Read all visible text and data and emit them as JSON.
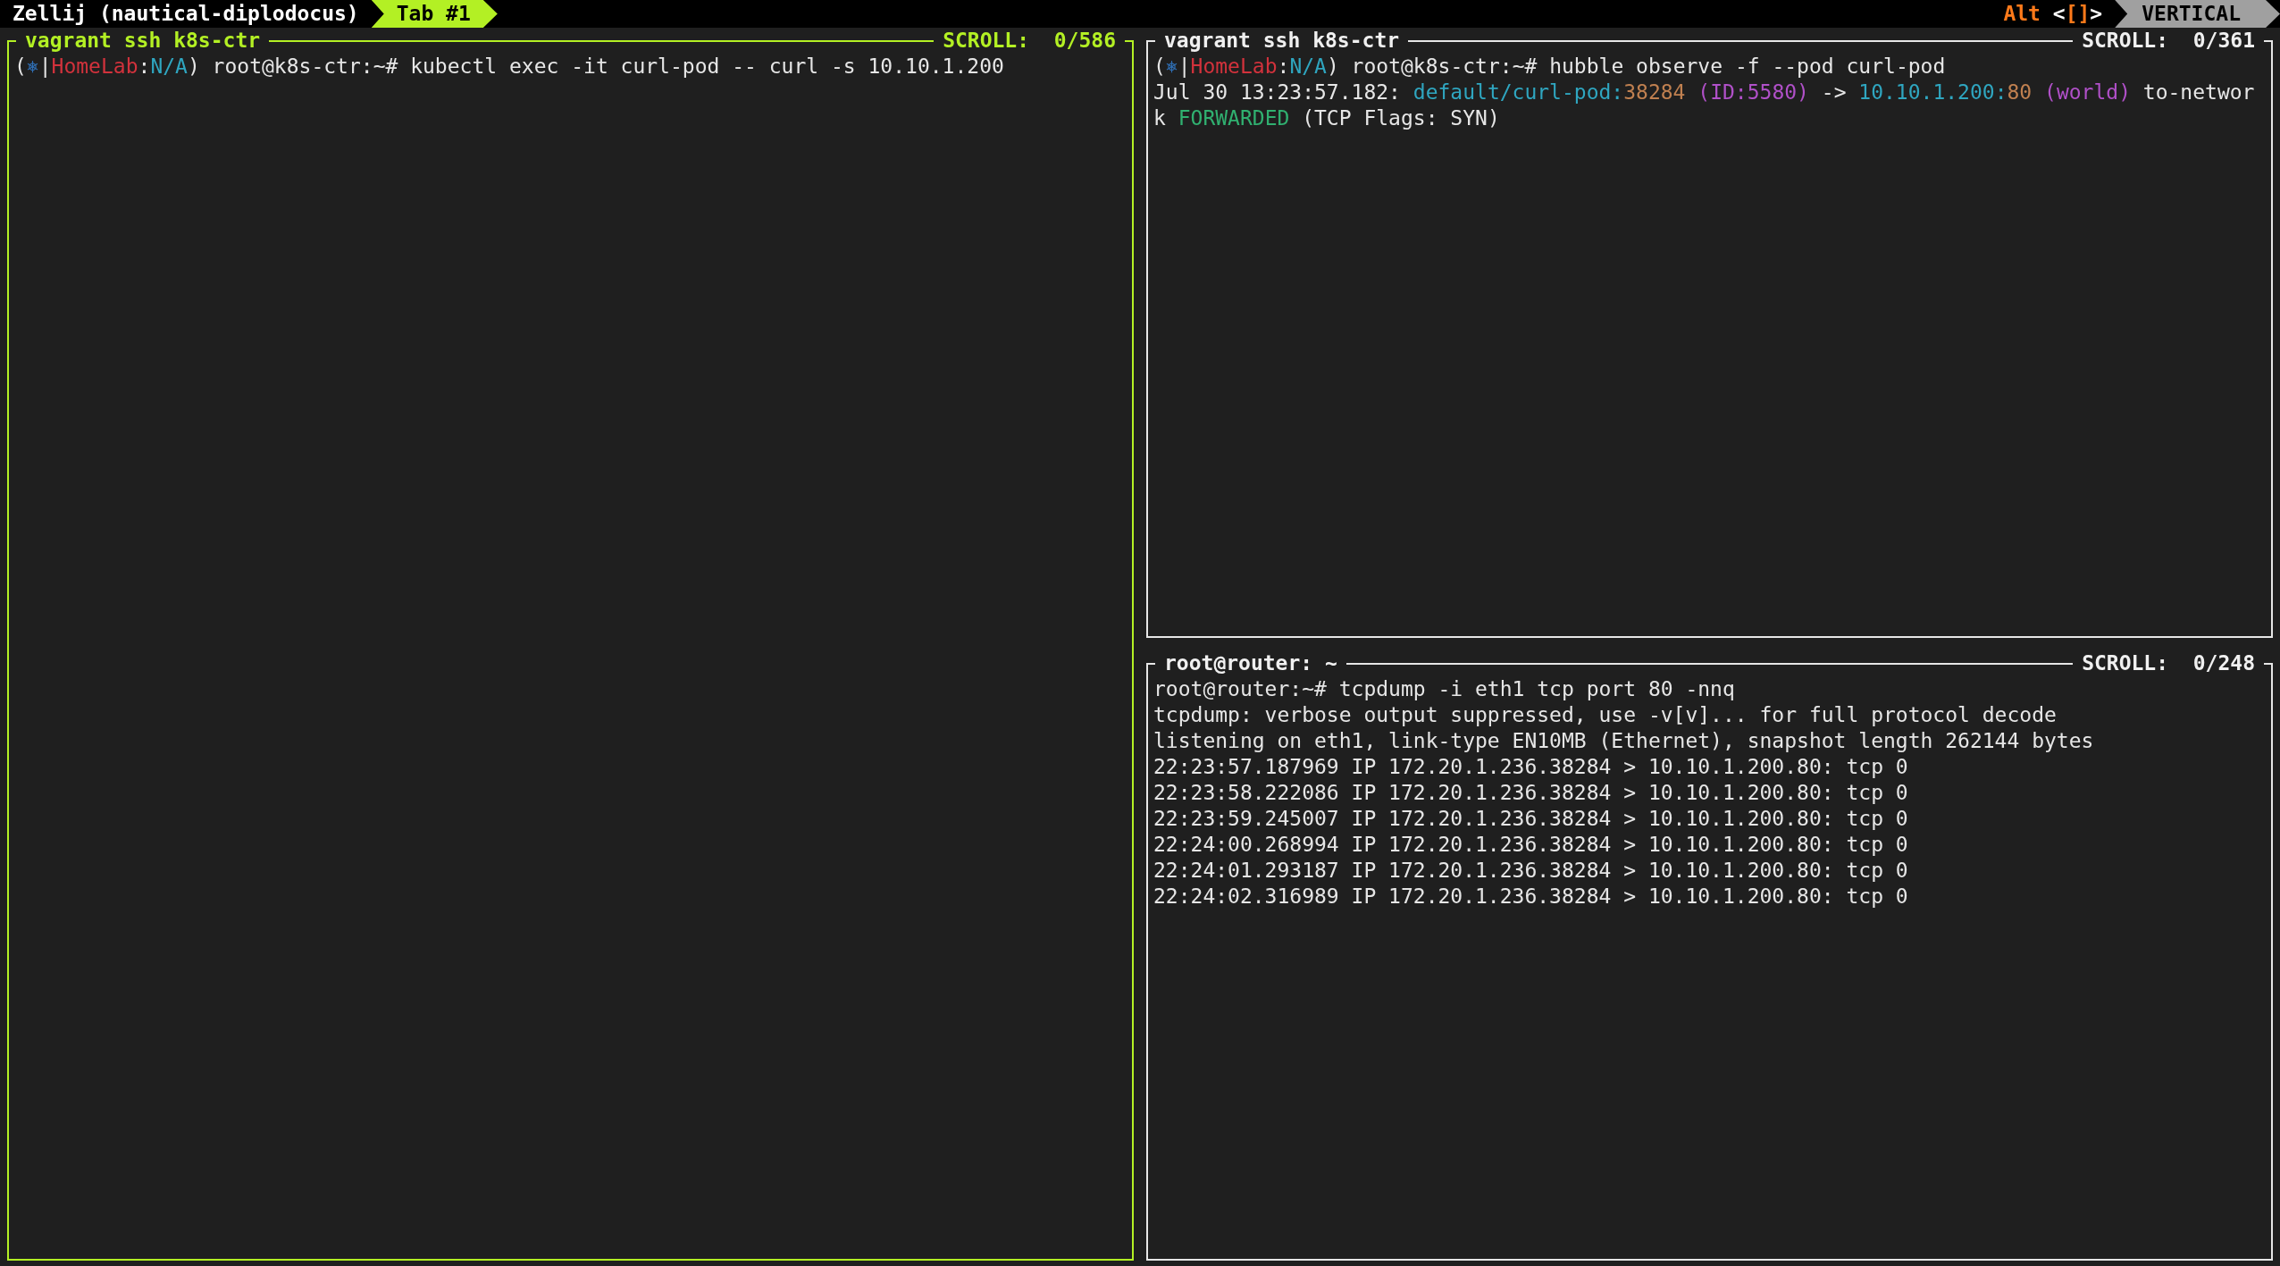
{
  "top_bar": {
    "session": "Zellij (nautical-diplodocus)",
    "tabs": [
      {
        "label": "Tab #1",
        "selected": true
      }
    ],
    "mode_key": "Alt",
    "mode_hint_open": "<",
    "mode_hint_keys": "[]",
    "mode_hint_close": ">",
    "layout": "VERTICAL"
  },
  "panes": [
    {
      "title": "vagrant ssh k8s-ctr",
      "scroll": "SCROLL:  0/586",
      "focused": true,
      "lines": [
        [
          {
            "text": "(",
            "kind": "plain"
          },
          {
            "text": "⎈",
            "kind": "icon"
          },
          {
            "text": "|",
            "kind": "plain"
          },
          {
            "text": "HomeLab",
            "kind": "host"
          },
          {
            "text": ":",
            "kind": "plain"
          },
          {
            "text": "N/A",
            "kind": "namespace"
          },
          {
            "text": ") root@k8s-ctr:~# kubectl exec -it curl-pod -- curl -s 10.10.1.200",
            "kind": "plain"
          }
        ]
      ]
    },
    {
      "title": "vagrant ssh k8s-ctr",
      "scroll": "SCROLL:  0/361",
      "focused": false,
      "lines": [
        [
          {
            "text": "(",
            "kind": "plain"
          },
          {
            "text": "⎈",
            "kind": "icon"
          },
          {
            "text": "|",
            "kind": "plain"
          },
          {
            "text": "HomeLab",
            "kind": "host"
          },
          {
            "text": ":",
            "kind": "plain"
          },
          {
            "text": "N/A",
            "kind": "namespace"
          },
          {
            "text": ") root@k8s-ctr:~# hubble observe -f --pod curl-pod",
            "kind": "plain"
          }
        ],
        [
          {
            "text": "Jul 30 13:23:57.182: ",
            "kind": "plain"
          },
          {
            "text": "default/curl-pod:",
            "kind": "namespace"
          },
          {
            "text": "38284",
            "kind": "port"
          },
          {
            "text": " (ID:5580)",
            "kind": "identity"
          },
          {
            "text": " -> ",
            "kind": "plain"
          },
          {
            "text": "10.10.1.200:",
            "kind": "namespace"
          },
          {
            "text": "80",
            "kind": "port"
          },
          {
            "text": " (world)",
            "kind": "identity"
          },
          {
            "text": " to-networ",
            "kind": "plain"
          }
        ],
        [
          {
            "text": "k ",
            "kind": "plain"
          },
          {
            "text": "FORWARDED",
            "kind": "verdict"
          },
          {
            "text": " (TCP Flags: SYN)",
            "kind": "plain"
          }
        ]
      ]
    },
    {
      "title": "root@router: ~",
      "scroll": "SCROLL:  0/248",
      "focused": false,
      "lines": [
        [
          {
            "text": "root@router:~# tcpdump -i eth1 tcp port 80 -nnq",
            "kind": "plain"
          }
        ],
        [
          {
            "text": "tcpdump: verbose output suppressed, use -v[v]... for full protocol decode",
            "kind": "plain"
          }
        ],
        [
          {
            "text": "listening on eth1, link-type EN10MB (Ethernet), snapshot length 262144 bytes",
            "kind": "plain"
          }
        ],
        [
          {
            "text": "22:23:57.187969 IP 172.20.1.236.38284 > 10.10.1.200.80: tcp 0",
            "kind": "plain"
          }
        ],
        [
          {
            "text": "22:23:58.222086 IP 172.20.1.236.38284 > 10.10.1.200.80: tcp 0",
            "kind": "plain"
          }
        ],
        [
          {
            "text": "22:23:59.245007 IP 172.20.1.236.38284 > 10.10.1.200.80: tcp 0",
            "kind": "plain"
          }
        ],
        [
          {
            "text": "22:24:00.268994 IP 172.20.1.236.38284 > 10.10.1.200.80: tcp 0",
            "kind": "plain"
          }
        ],
        [
          {
            "text": "22:24:01.293187 IP 172.20.1.236.38284 > 10.10.1.200.80: tcp 0",
            "kind": "plain"
          }
        ],
        [
          {
            "text": "22:24:02.316989 IP 172.20.1.236.38284 > 10.10.1.200.80: tcp 0",
            "kind": "plain"
          }
        ]
      ]
    }
  ]
}
